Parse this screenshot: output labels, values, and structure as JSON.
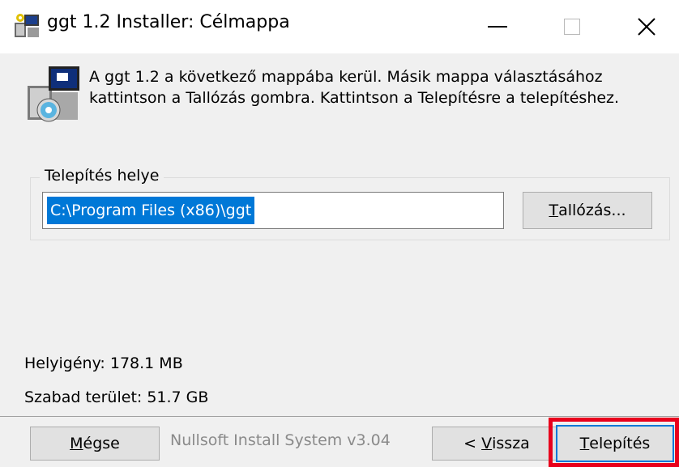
{
  "window": {
    "title": "ggt 1.2 Installer: Célmappa",
    "icon": "installer-icon",
    "controls": [
      "minimize-icon",
      "maximize-icon",
      "close-icon"
    ]
  },
  "header": {
    "icon": "package-disk-icon",
    "line1": "A ggt 1.2 a következő mappába kerül. Másik mappa választásához",
    "line2": "kattintson a Tallózás gombra. Kattintson a Telepítésre a telepítéshez."
  },
  "destination": {
    "group_label": "Telepítés helye",
    "path_value": "C:\\Program Files (x86)\\ggt",
    "browse_button_first": "T",
    "browse_button_rest": "allózás..."
  },
  "space": {
    "required": "Helyigény: 178.1 MB",
    "free": "Szabad terület: 51.7 GB"
  },
  "footer": {
    "branding": "Nullsoft Install System v3.04",
    "cancel_first": "M",
    "cancel_rest": "égse",
    "back_prefix": "< ",
    "back_first": "V",
    "back_rest": "issza",
    "install_first": "T",
    "install_rest": "elepítés"
  },
  "colors": {
    "selection": "#0078d7",
    "highlight": "#e8001c"
  }
}
